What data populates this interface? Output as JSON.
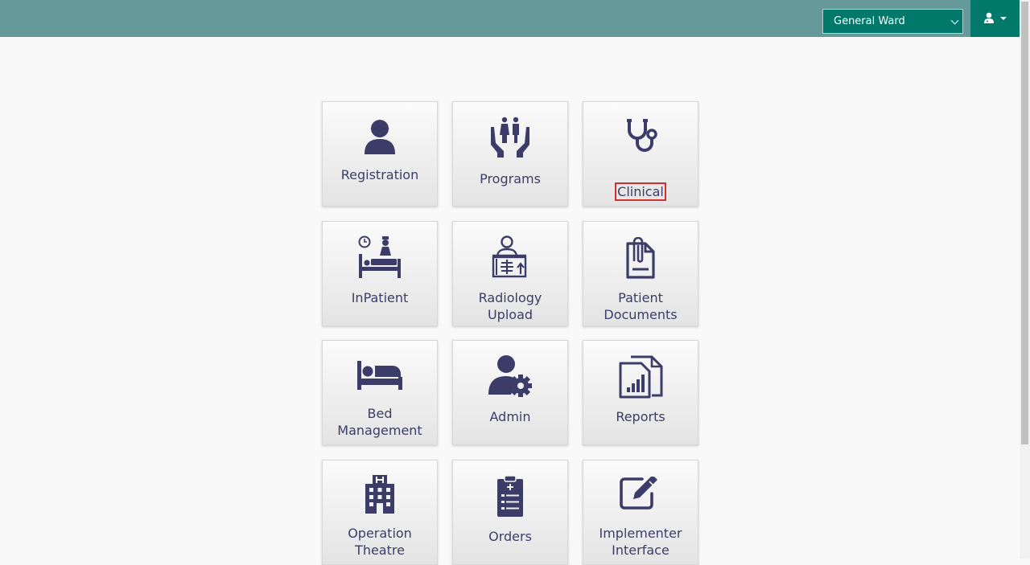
{
  "header": {
    "location_select": {
      "value": "General Ward",
      "icon": "chevron-down-icon"
    },
    "user_menu": {
      "icon": "doctor-user-icon",
      "caret_icon": "caret-down-icon"
    },
    "colors": {
      "bar": "#669999",
      "accent": "#00796b"
    }
  },
  "apps": [
    {
      "label": "Registration",
      "icon": "person-icon"
    },
    {
      "label": "Programs",
      "icon": "hands-family-icon"
    },
    {
      "label": "Clinical",
      "icon": "stethoscope-icon",
      "highlighted": true
    },
    {
      "label": "InPatient",
      "icon": "hospital-bed-nurse-icon"
    },
    {
      "label": "Radiology\nUpload",
      "icon": "xray-icon"
    },
    {
      "label": "Patient\nDocuments",
      "icon": "document-clip-icon"
    },
    {
      "label": "Bed\nManagement",
      "icon": "bed-icon"
    },
    {
      "label": "Admin",
      "icon": "user-gear-icon"
    },
    {
      "label": "Reports",
      "icon": "report-chart-icon"
    },
    {
      "label": "Operation\nTheatre",
      "icon": "hospital-building-icon"
    },
    {
      "label": "Orders",
      "icon": "clipboard-list-icon"
    },
    {
      "label": "Implementer\nInterface",
      "icon": "edit-icon"
    }
  ]
}
